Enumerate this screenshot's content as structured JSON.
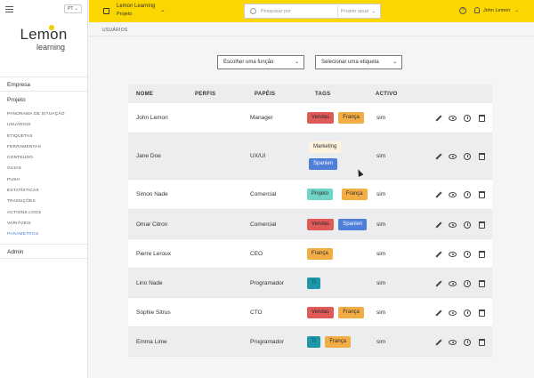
{
  "sidebar": {
    "lang": "PT",
    "logo_main": "Lemon",
    "logo_sub": "learning",
    "empresa": "Empresa",
    "projeto": "Projeto",
    "items": [
      {
        "label": "Panorama de situação",
        "active": false
      },
      {
        "label": "Usuários",
        "active": false
      },
      {
        "label": "Etiquetas",
        "active": false
      },
      {
        "label": "Ferramentas",
        "active": false
      },
      {
        "label": "Conteúdo",
        "active": false
      },
      {
        "label": "Guias",
        "active": false
      },
      {
        "label": "Push",
        "active": false
      },
      {
        "label": "Estatísticas",
        "active": false
      },
      {
        "label": "Traduções",
        "active": false
      },
      {
        "label": "Actions logs",
        "active": false
      },
      {
        "label": "Variáveis",
        "active": false
      },
      {
        "label": "Parâmetros",
        "active": true
      }
    ],
    "admin": "Admin"
  },
  "topbar": {
    "project_name": "Lemon Learning",
    "project_sub": "Projeto",
    "search_placeholder": "Pesquisar por",
    "search_scope": "Projeto atual",
    "user_name": "John Lemon",
    "help_icon_label": "?"
  },
  "breadcrumb": "USUÁRIOS",
  "filters": {
    "function": "Escolher uma função",
    "tag": "Selecionar uma etiqueta"
  },
  "table": {
    "headers": {
      "name": "NOME",
      "perfis": "PERFIS",
      "papeis": "PAPÉIS",
      "tags": "TAGS",
      "activo": "ACTIVO"
    },
    "rows": [
      {
        "name": "John Lemon",
        "role": "Manager",
        "tags": [
          {
            "label": "Vendas",
            "color": "red"
          },
          {
            "label": "França",
            "color": "orange"
          }
        ],
        "active": "sim"
      },
      {
        "name": "Jane Doe",
        "role": "UX/UI",
        "tags": [
          {
            "label": "Marketing",
            "color": "cream"
          },
          {
            "label": "Spanien",
            "color": "blue"
          }
        ],
        "active": "sim"
      },
      {
        "name": "Simon Nade",
        "role": "Comercial",
        "tags": [
          {
            "label": "Projeto",
            "color": "teal"
          },
          {
            "label": "França",
            "color": "orange"
          }
        ],
        "active": "sim"
      },
      {
        "name": "Omar Citron",
        "role": "Comercial",
        "tags": [
          {
            "label": "Vendas",
            "color": "red"
          },
          {
            "label": "Spanien",
            "color": "blue"
          }
        ],
        "active": "sim"
      },
      {
        "name": "Pierre Leroux",
        "role": "CEO",
        "tags": [
          {
            "label": "França",
            "color": "orange"
          }
        ],
        "active": "sim"
      },
      {
        "name": "Lino Nade",
        "role": "Programador",
        "tags": [
          {
            "label": "TI",
            "color": "darkteal"
          }
        ],
        "active": "sim"
      },
      {
        "name": "Sophie Sitrus",
        "role": "CTO",
        "tags": [
          {
            "label": "Vendas",
            "color": "red"
          },
          {
            "label": "França",
            "color": "orange"
          }
        ],
        "active": "sim"
      },
      {
        "name": "Emma Lime",
        "role": "Programador",
        "tags": [
          {
            "label": "TI",
            "color": "darkteal"
          },
          {
            "label": "França",
            "color": "orange"
          }
        ],
        "active": "sim"
      }
    ]
  },
  "tag_colors": {
    "red": "#e05a57",
    "orange": "#f2ae45",
    "blue": "#4f7fd8",
    "teal": "#6fd6c6",
    "darkteal": "#1e97a8",
    "cream": "#fdf3df"
  },
  "colors": {
    "accent": "#fbd600",
    "active_link": "#4a7fd0"
  }
}
